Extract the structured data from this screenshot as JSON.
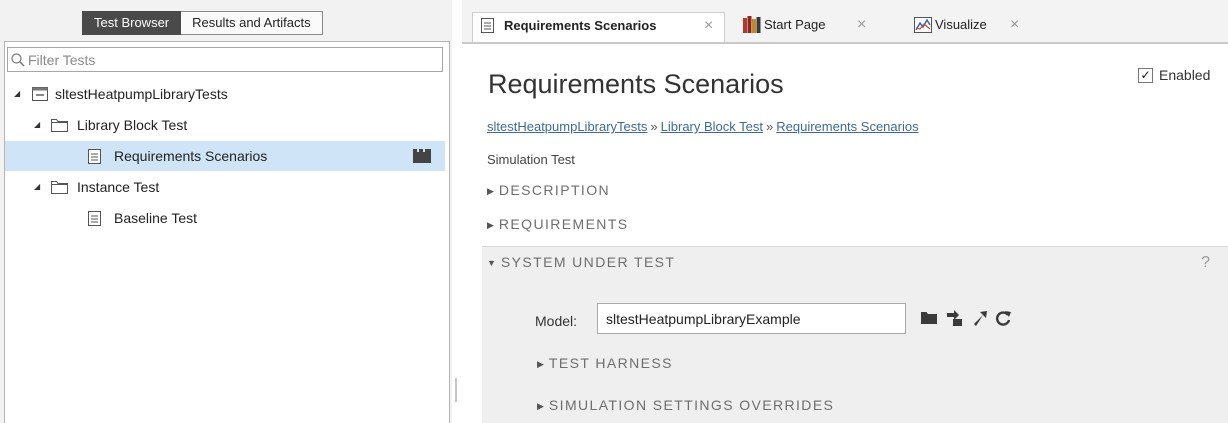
{
  "left_tabs": {
    "test_browser": "Test Browser",
    "results": "Results and Artifacts"
  },
  "filter": {
    "placeholder": "Filter Tests",
    "value": ""
  },
  "tree": {
    "file": "sltestHeatpumpLibraryTests",
    "suite1": "Library Block Test",
    "case1": "Requirements Scenarios",
    "suite2": "Instance Test",
    "case2": "Baseline Test"
  },
  "doc_tabs": {
    "tab1": {
      "label": "Requirements Scenarios",
      "close": "×",
      "icon": "document-icon"
    },
    "tab2": {
      "label": "Start Page",
      "close": "×",
      "icon": "books-icon"
    },
    "tab3": {
      "label": "Visualize",
      "close": "×",
      "icon": "chart-icon"
    }
  },
  "page": {
    "title": "Requirements Scenarios",
    "enabled_label": "Enabled",
    "enabled_checked": true,
    "checkmark": "✓",
    "breadcrumb": {
      "c1": "sltestHeatpumpLibraryTests",
      "c2": "Library Block Test",
      "c3": "Requirements Scenarios",
      "sep": "»"
    },
    "test_type": "Simulation Test",
    "sections": {
      "description": "DESCRIPTION",
      "requirements": "REQUIREMENTS",
      "sut": "SYSTEM UNDER TEST",
      "help": "?"
    },
    "sut": {
      "model_label": "Model:",
      "model_value": "sltestHeatpumpLibraryExample",
      "test_harness": "TEST HARNESS",
      "sim_overrides": "SIMULATION SETTINGS OVERRIDES"
    }
  },
  "colors": {
    "selection": "#cfe5f7",
    "link": "#3d6b93",
    "active_tab": "#4a4a4a",
    "section_text": "#6e6e6e"
  }
}
